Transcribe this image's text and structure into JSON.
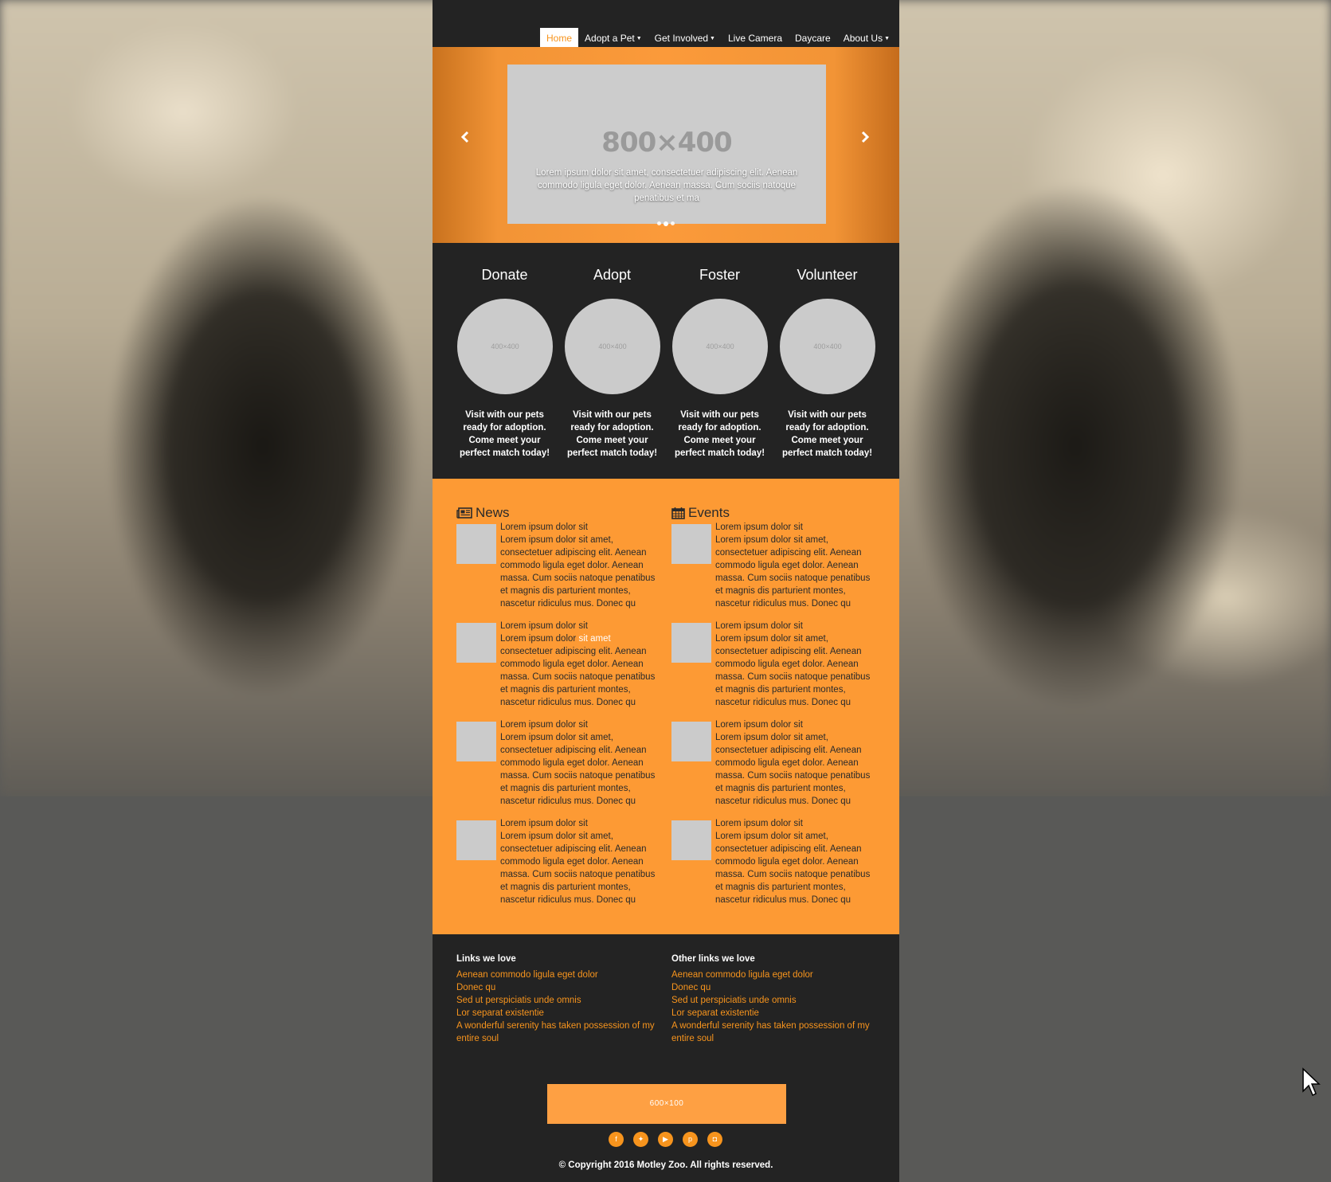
{
  "nav": {
    "items": [
      {
        "label": "Home",
        "active": true,
        "dropdown": false
      },
      {
        "label": "Adopt a Pet",
        "active": false,
        "dropdown": true
      },
      {
        "label": "Get Involved",
        "active": false,
        "dropdown": true
      },
      {
        "label": "Live Camera",
        "active": false,
        "dropdown": false
      },
      {
        "label": "Daycare",
        "active": false,
        "dropdown": false
      },
      {
        "label": "About Us",
        "active": false,
        "dropdown": true
      }
    ]
  },
  "hero": {
    "placeholder": "800×400",
    "caption": "Lorem ipsum dolor sit amet, consectetuer adipiscing elit. Aenean commodo ligula eget dolor. Aenean massa. Cum sociis natoque penatibus et ma",
    "prev_icon": "chevron-left-icon",
    "next_icon": "chevron-right-icon",
    "slide_count": 3,
    "active_slide": 2
  },
  "features": [
    {
      "title": "Donate",
      "placeholder": "400×400",
      "text": "Visit with our pets ready for adoption. Come meet your perfect match today!"
    },
    {
      "title": "Adopt",
      "placeholder": "400×400",
      "text": "Visit with our pets ready for adoption. Come meet your perfect match today!"
    },
    {
      "title": "Foster",
      "placeholder": "400×400",
      "text": "Visit with our pets ready for adoption. Come meet your perfect match today!"
    },
    {
      "title": "Volunteer",
      "placeholder": "400×400",
      "text": "Visit with our pets ready for adoption. Come meet your perfect match today!"
    }
  ],
  "news": {
    "title": "News",
    "icon": "newspaper-icon",
    "items": [
      {
        "title": "Lorem ipsum dolor sit",
        "body": "Lorem ipsum dolor sit amet, consectetuer adipiscing elit. Aenean commodo ligula eget dolor. Aenean massa. Cum sociis natoque penatibus et magnis dis parturient montes, nascetur ridiculus mus. Donec qu"
      },
      {
        "title": "Lorem ipsum dolor sit",
        "body_pre": "Lorem ipsum dolor ",
        "body_hl": "sit amet",
        "body_post": " consectetuer adipiscing elit. Aenean commodo ligula eget dolor. Aenean massa. Cum sociis natoque penatibus et magnis dis parturient montes, nascetur ridiculus mus. Donec qu"
      },
      {
        "title": "Lorem ipsum dolor sit",
        "body": "Lorem ipsum dolor sit amet, consectetuer adipiscing elit. Aenean commodo ligula eget dolor. Aenean massa. Cum sociis natoque penatibus et magnis dis parturient montes, nascetur ridiculus mus. Donec qu"
      },
      {
        "title": "Lorem ipsum dolor sit",
        "body": "Lorem ipsum dolor sit amet, consectetuer adipiscing elit. Aenean commodo ligula eget dolor. Aenean massa. Cum sociis natoque penatibus et magnis dis parturient montes, nascetur ridiculus mus. Donec qu"
      }
    ]
  },
  "events": {
    "title": "Events",
    "icon": "calendar-icon",
    "items": [
      {
        "title": "Lorem ipsum dolor sit",
        "body": "Lorem ipsum dolor sit amet, consectetuer adipiscing elit. Aenean commodo ligula eget dolor. Aenean massa. Cum sociis natoque penatibus et magnis dis parturient montes, nascetur ridiculus mus. Donec qu"
      },
      {
        "title": "Lorem ipsum dolor sit",
        "body": "Lorem ipsum dolor sit amet, consectetuer adipiscing elit. Aenean commodo ligula eget dolor. Aenean massa. Cum sociis natoque penatibus et magnis dis parturient montes, nascetur ridiculus mus. Donec qu"
      },
      {
        "title": "Lorem ipsum dolor sit",
        "body": "Lorem ipsum dolor sit amet, consectetuer adipiscing elit. Aenean commodo ligula eget dolor. Aenean massa. Cum sociis natoque penatibus et magnis dis parturient montes, nascetur ridiculus mus. Donec qu"
      },
      {
        "title": "Lorem ipsum dolor sit",
        "body": "Lorem ipsum dolor sit amet, consectetuer adipiscing elit. Aenean commodo ligula eget dolor. Aenean massa. Cum sociis natoque penatibus et magnis dis parturient montes, nascetur ridiculus mus. Donec qu"
      }
    ]
  },
  "footer": {
    "links_left": {
      "title": "Links we love",
      "links": [
        "Aenean commodo ligula eget dolor",
        "Donec qu",
        "Sed ut perspiciatis unde omnis",
        "Lor separat existentie",
        "A wonderful serenity has taken possession of my entire soul"
      ]
    },
    "links_right": {
      "title": "Other links we love",
      "links": [
        "Aenean commodo ligula eget dolor",
        "Donec qu",
        "Sed ut perspiciatis unde omnis",
        "Lor separat existentie",
        "A wonderful serenity has taken possession of my entire soul"
      ]
    },
    "banner": "600×100",
    "social": [
      "facebook-icon",
      "twitter-icon",
      "youtube-icon",
      "pinterest-icon",
      "instagram-icon"
    ],
    "copyright": "© Copyright 2016 Motley Zoo. All rights reserved."
  },
  "colors": {
    "accent": "#f7941d",
    "content_bg": "#fd9a34",
    "dark_bg": "#232323",
    "placeholder": "#cccccc"
  }
}
